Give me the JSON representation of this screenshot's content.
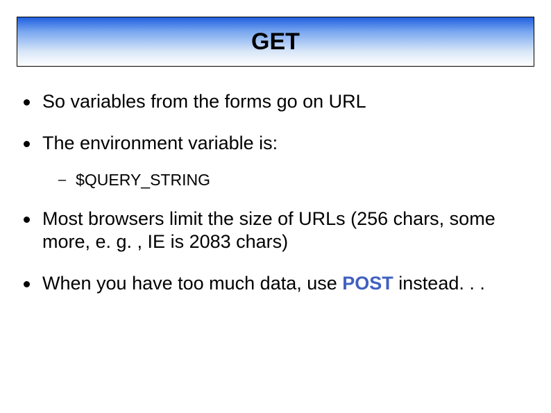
{
  "title": "GET",
  "bullets": {
    "b1": "So variables from the forms go on URL",
    "b2": "The environment variable is:",
    "sub1": "$QUERY_STRING",
    "b3": "Most browsers limit the size of URLs (256 chars, some more, e. g. , IE is 2083 chars)",
    "b4_prefix": "When you have too much data, use ",
    "b4_highlight": "POST",
    "b4_suffix": " instead. . ."
  }
}
